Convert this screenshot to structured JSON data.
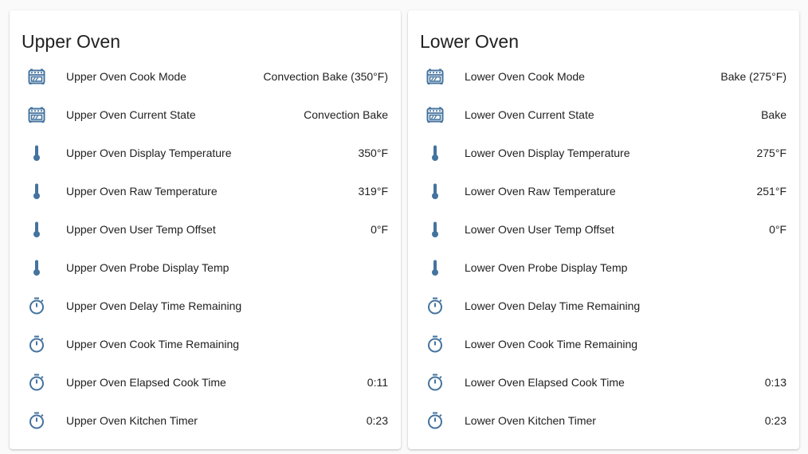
{
  "theme": {
    "icon_color": "#44739e"
  },
  "cards": [
    {
      "title": "Upper Oven",
      "rows": [
        {
          "icon": "stove-icon",
          "name": "Upper Oven Cook Mode",
          "state": "Convection Bake (350°F)"
        },
        {
          "icon": "stove-icon",
          "name": "Upper Oven Current State",
          "state": "Convection Bake"
        },
        {
          "icon": "thermometer-icon",
          "name": "Upper Oven Display Temperature",
          "state": "350°F"
        },
        {
          "icon": "thermometer-icon",
          "name": "Upper Oven Raw Temperature",
          "state": "319°F"
        },
        {
          "icon": "thermometer-icon",
          "name": "Upper Oven User Temp Offset",
          "state": "0°F"
        },
        {
          "icon": "thermometer-icon",
          "name": "Upper Oven Probe Display Temp",
          "state": ""
        },
        {
          "icon": "timer-icon",
          "name": "Upper Oven Delay Time Remaining",
          "state": ""
        },
        {
          "icon": "timer-icon",
          "name": "Upper Oven Cook Time Remaining",
          "state": ""
        },
        {
          "icon": "timer-icon",
          "name": "Upper Oven Elapsed Cook Time",
          "state": "0:11"
        },
        {
          "icon": "timer-icon",
          "name": "Upper Oven Kitchen Timer",
          "state": "0:23"
        }
      ]
    },
    {
      "title": "Lower Oven",
      "rows": [
        {
          "icon": "stove-icon",
          "name": "Lower Oven Cook Mode",
          "state": "Bake (275°F)"
        },
        {
          "icon": "stove-icon",
          "name": "Lower Oven Current State",
          "state": "Bake"
        },
        {
          "icon": "thermometer-icon",
          "name": "Lower Oven Display Temperature",
          "state": "275°F"
        },
        {
          "icon": "thermometer-icon",
          "name": "Lower Oven Raw Temperature",
          "state": "251°F"
        },
        {
          "icon": "thermometer-icon",
          "name": "Lower Oven User Temp Offset",
          "state": "0°F"
        },
        {
          "icon": "thermometer-icon",
          "name": "Lower Oven Probe Display Temp",
          "state": ""
        },
        {
          "icon": "timer-icon",
          "name": "Lower Oven Delay Time Remaining",
          "state": ""
        },
        {
          "icon": "timer-icon",
          "name": "Lower Oven Cook Time Remaining",
          "state": ""
        },
        {
          "icon": "timer-icon",
          "name": "Lower Oven Elapsed Cook Time",
          "state": "0:13"
        },
        {
          "icon": "timer-icon",
          "name": "Lower Oven Kitchen Timer",
          "state": "0:23"
        }
      ]
    }
  ]
}
